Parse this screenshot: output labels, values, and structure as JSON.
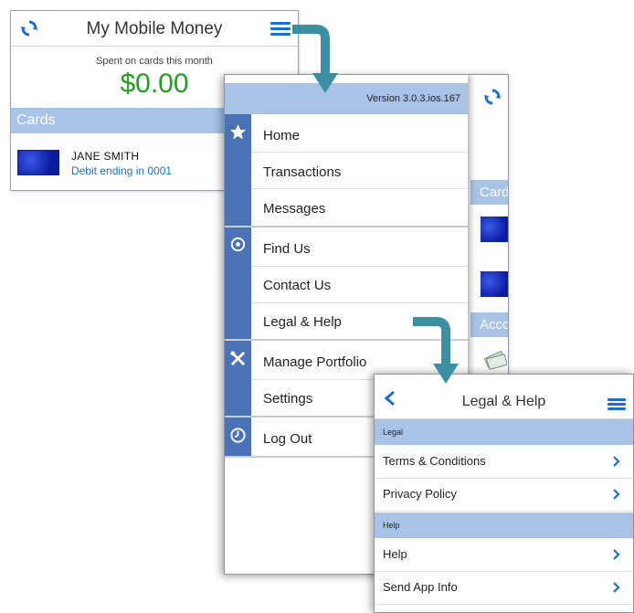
{
  "home": {
    "title": "My Mobile Money",
    "spent_label": "Spent on cards this month",
    "spent_amount": "$0.00",
    "cards_header": "Cards",
    "card": {
      "name": "JANE SMITH",
      "sub": "Debit ending in 0001"
    }
  },
  "menu": {
    "version": "Version 3.0.3.ios.167",
    "items": [
      {
        "label": "Home"
      },
      {
        "label": "Transactions"
      },
      {
        "label": "Messages"
      },
      {
        "label": "Find Us"
      },
      {
        "label": "Contact Us"
      },
      {
        "label": "Legal & Help"
      },
      {
        "label": "Manage Portfolio"
      },
      {
        "label": "Settings"
      },
      {
        "label": "Log Out"
      }
    ],
    "background": {
      "cards_partial": "Cards",
      "accounts_partial": "Accounts"
    }
  },
  "legal": {
    "title": "Legal & Help",
    "sections": [
      {
        "header": "Legal",
        "rows": [
          {
            "label": "Terms & Conditions"
          },
          {
            "label": "Privacy Policy"
          }
        ]
      },
      {
        "header": "Help",
        "rows": [
          {
            "label": "Help"
          },
          {
            "label": "Send App Info"
          }
        ]
      }
    ]
  },
  "colors": {
    "accent_blue": "#1a6fd1",
    "header_blue": "#a8c3e6",
    "rail_blue": "#4a72b4",
    "amount_green": "#1ea11e",
    "arrow_teal": "#3a8fa3"
  }
}
